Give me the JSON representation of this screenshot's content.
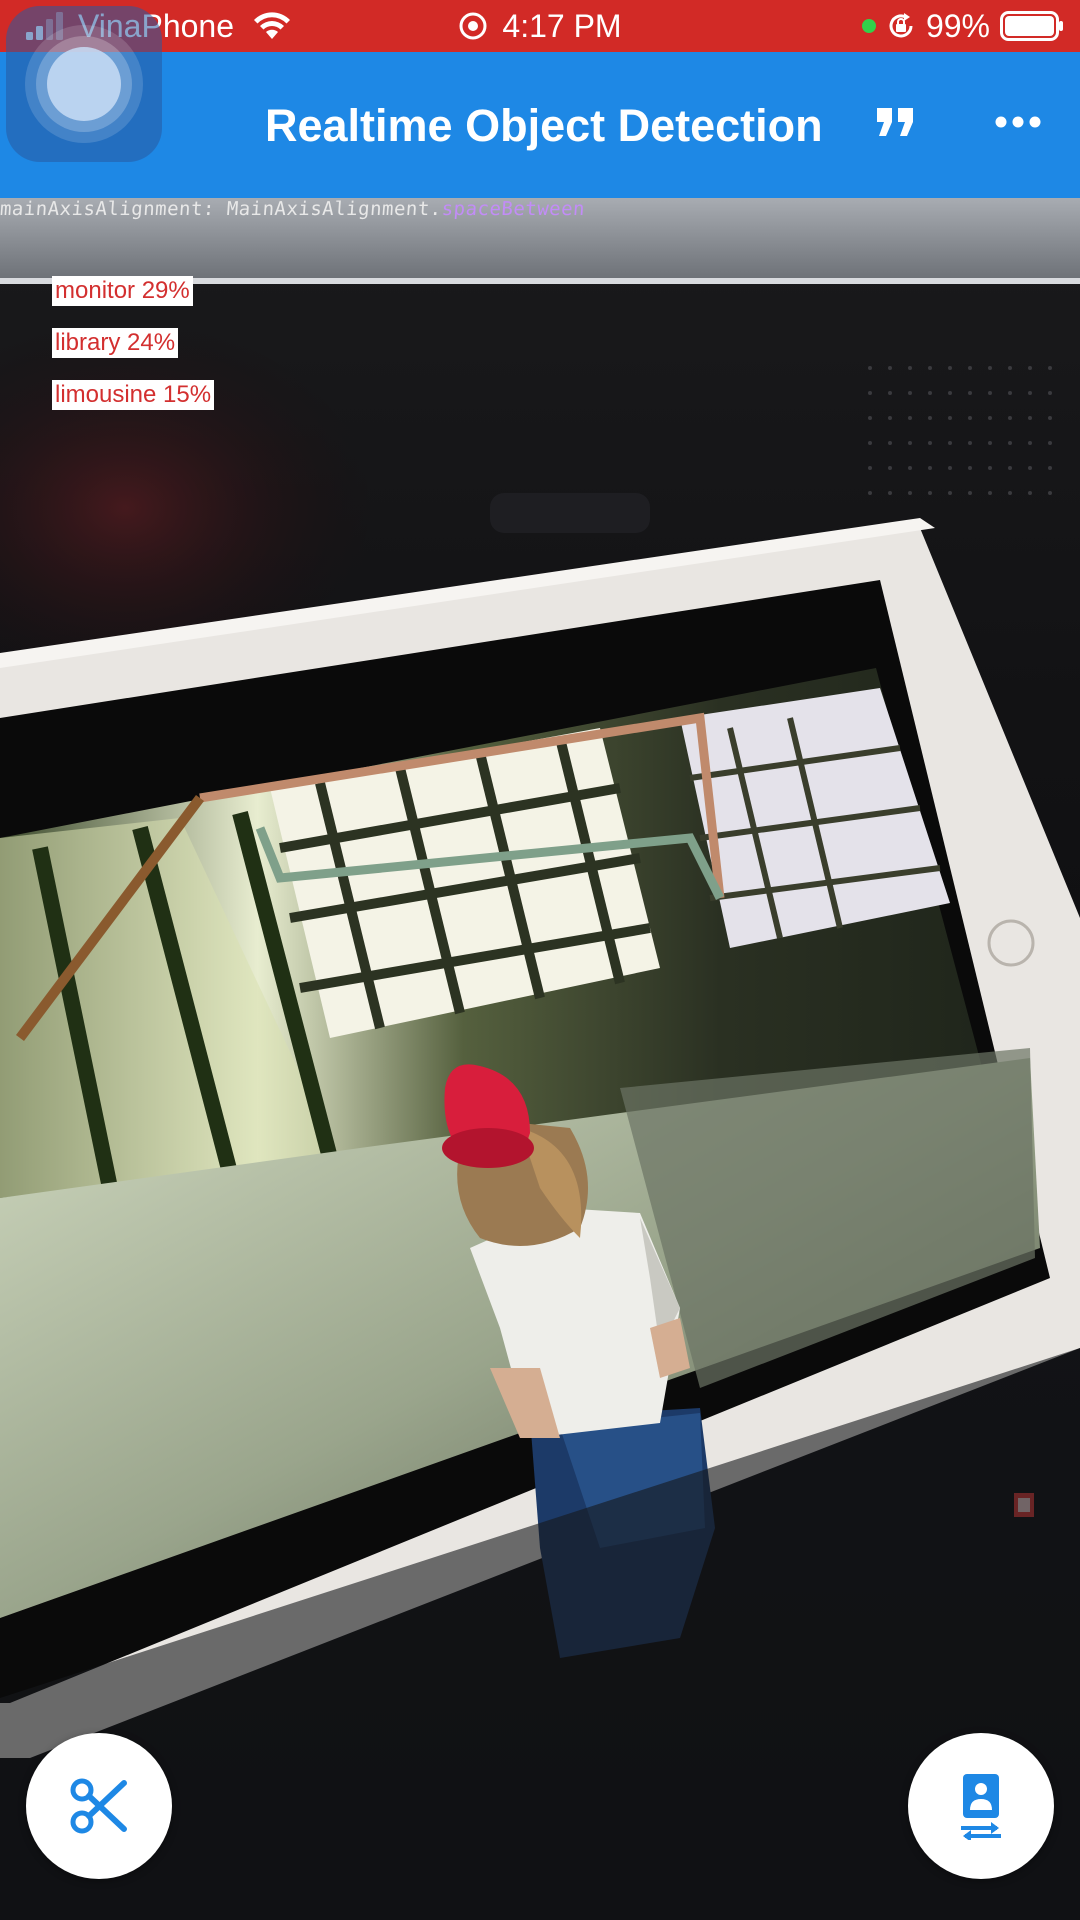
{
  "status_bar": {
    "carrier": "VinaPhone",
    "time": "4:17 PM",
    "battery": "99%",
    "icons": [
      "signal-icon",
      "wifi-icon",
      "location-icon",
      "green-dot",
      "orientation-lock-icon",
      "battery-icon"
    ]
  },
  "app_bar": {
    "title": "Realtime Object Detection",
    "actions": [
      "quote-icon",
      "more-horizontal-icon"
    ],
    "color": "#1e88e5"
  },
  "camera": {
    "code_text_prefix": "mainAxisAlignment: MainAxisAlignment.",
    "code_text_keyword": "spaceBetween"
  },
  "detections": [
    {
      "label": "monitor 29%"
    },
    {
      "label": "library 24%"
    },
    {
      "label": "limousine 15%"
    }
  ],
  "buttons": {
    "left_icon": "scissors-icon",
    "right_icon": "switch-camera-icon",
    "accent": "#1e88e5"
  },
  "colors": {
    "status_bar": "#d22a26",
    "detection_text": "#d32f2f"
  }
}
